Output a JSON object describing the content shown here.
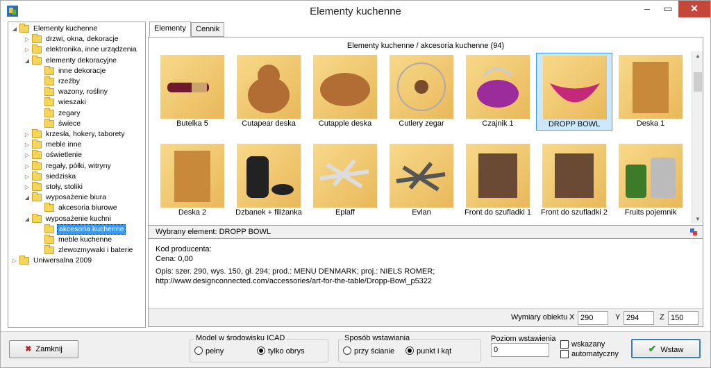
{
  "window": {
    "title": "Elementy kuchenne",
    "minimize": "–",
    "maximize": "▭",
    "close": "✕"
  },
  "tree": [
    {
      "label": "Elementy kuchenne",
      "level": 0,
      "exp": "◢"
    },
    {
      "label": "drzwi, okna, dekoracje",
      "level": 1,
      "exp": "▷"
    },
    {
      "label": "elektronika, inne urządzenia",
      "level": 1,
      "exp": "▷"
    },
    {
      "label": "elementy dekoracyjne",
      "level": 1,
      "exp": "◢"
    },
    {
      "label": "inne dekoracje",
      "level": 2,
      "exp": ""
    },
    {
      "label": "rzeźby",
      "level": 2,
      "exp": ""
    },
    {
      "label": "wazony, rośliny",
      "level": 2,
      "exp": ""
    },
    {
      "label": "wieszaki",
      "level": 2,
      "exp": ""
    },
    {
      "label": "zegary",
      "level": 2,
      "exp": ""
    },
    {
      "label": "świece",
      "level": 2,
      "exp": ""
    },
    {
      "label": "krzesła, hokery, taborety",
      "level": 1,
      "exp": "▷"
    },
    {
      "label": "meble inne",
      "level": 1,
      "exp": "▷"
    },
    {
      "label": "oświetlenie",
      "level": 1,
      "exp": "▷"
    },
    {
      "label": "regały, półki, witryny",
      "level": 1,
      "exp": "▷"
    },
    {
      "label": "siedziska",
      "level": 1,
      "exp": "▷"
    },
    {
      "label": "stoły, stoliki",
      "level": 1,
      "exp": "▷"
    },
    {
      "label": "wyposażenie biura",
      "level": 1,
      "exp": "◢"
    },
    {
      "label": "akcesoria biurowe",
      "level": 2,
      "exp": ""
    },
    {
      "label": "wyposażenie kuchni",
      "level": 1,
      "exp": "◢"
    },
    {
      "label": "akcesoria kuchenne",
      "level": 2,
      "exp": "",
      "selected": true
    },
    {
      "label": "meble kuchenne",
      "level": 2,
      "exp": ""
    },
    {
      "label": "zlewozmywaki i baterie",
      "level": 2,
      "exp": ""
    },
    {
      "label": "Uniwersalna 2009",
      "level": 0,
      "exp": "▷"
    }
  ],
  "tabs": [
    {
      "label": "Elementy",
      "active": true
    },
    {
      "label": "Cennik",
      "active": false
    }
  ],
  "category_header": "Elementy kuchenne / akcesoria kuchenne (94)",
  "items": [
    {
      "label": "Butelka 5",
      "icon": "wine-bottle-icon"
    },
    {
      "label": "Cutapear deska",
      "icon": "pear-board-icon"
    },
    {
      "label": "Cutapple deska",
      "icon": "apple-board-icon"
    },
    {
      "label": "Cutlery zegar",
      "icon": "cutlery-clock-icon"
    },
    {
      "label": "Czajnik 1",
      "icon": "kettle-icon"
    },
    {
      "label": "DROPP BOWL",
      "icon": "bowl-icon",
      "selected": true
    },
    {
      "label": "Deska 1",
      "icon": "board-icon"
    },
    {
      "label": "Deska 2",
      "icon": "board-icon"
    },
    {
      "label": "Dzbanek + filiżanka",
      "icon": "jug-cup-icon"
    },
    {
      "label": "Eplaff",
      "icon": "trivet-icon"
    },
    {
      "label": "Evlan",
      "icon": "trivet-dark-icon"
    },
    {
      "label": "Front do szufladki 1",
      "icon": "drawer-front-icon"
    },
    {
      "label": "Front do szufladki 2",
      "icon": "drawer-front-icon"
    },
    {
      "label": "Fruits pojemnik",
      "icon": "jars-icon"
    }
  ],
  "selected_element": "Wybrany element: DROPP BOWL",
  "info": {
    "kod": "Kod producenta:",
    "cena": "Cena: 0,00",
    "opis1": "Opis: szer. 290, wys. 150, gł. 294; prod.: MENU DENMARK; proj.: NIELS ROMER;",
    "opis2": "http://www.designconnected.com/accessories/art-for-the-table/Dropp-Bowl_p5322"
  },
  "dims": {
    "label": "Wymiary obiektu",
    "x_label": "X",
    "x": "290",
    "y_label": "Y",
    "y": "294",
    "z_label": "Z",
    "z": "150"
  },
  "bottom": {
    "close_label": "Zamknij",
    "model_title": "Model w środowisku ICAD",
    "model_full": "pełny",
    "model_outline": "tylko obrys",
    "insert_title": "Sposób wstawiania",
    "insert_wall": "przy ścianie",
    "insert_point": "punkt i kąt",
    "level_title": "Poziom wstawienia",
    "level_value": "0",
    "chk_shown": "wskazany",
    "chk_auto": "automatyczny",
    "insert_label": "Wstaw"
  }
}
